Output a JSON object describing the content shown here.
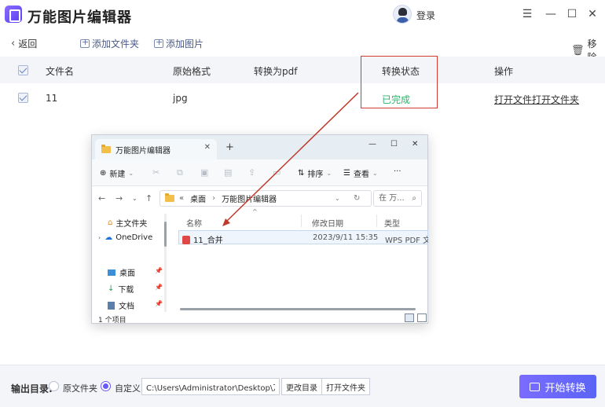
{
  "app": {
    "title": "万能图片编辑器",
    "login": "登录"
  },
  "toolbar": {
    "back": "返回",
    "add_folder": "添加文件夹",
    "add_image": "添加图片",
    "remove": "移除"
  },
  "table": {
    "headers": [
      "文件名",
      "原始格式",
      "转换为pdf",
      "转换状态",
      "操作"
    ],
    "rows": [
      {
        "name": "11",
        "format": "jpg",
        "status": "已完成",
        "open_file": "打开文件",
        "open_folder": "打开文件夹"
      }
    ]
  },
  "explorer": {
    "tab_title": "万能图片编辑器",
    "new_tab": "+",
    "cmd": {
      "new": "新建",
      "sort": "排序",
      "view": "查看",
      "more": "···"
    },
    "breadcrumb": [
      "«",
      "桌面",
      "›",
      "万能图片编辑器"
    ],
    "search_placeholder": "在 万...",
    "sidebar": [
      "主文件夹",
      "OneDrive",
      "桌面",
      "下载",
      "文档"
    ],
    "columns": [
      "名称",
      "修改日期",
      "类型"
    ],
    "files": [
      {
        "name": "11_合并",
        "date": "2023/9/11 15:35",
        "type": "WPS PDF 文档"
      }
    ],
    "status": "1 个项目"
  },
  "footer": {
    "output_label": "输出目录:",
    "option_source": "原文件夹",
    "option_custom": "自定义",
    "path": "C:\\Users\\Administrator\\Desktop\\万...",
    "change_dir": "更改目录",
    "open_folder": "打开文件夹",
    "start": "开始转换"
  },
  "colors": {
    "accent": "#6a5af9",
    "status_done": "#2bb36b",
    "highlight": "#d23b30"
  }
}
